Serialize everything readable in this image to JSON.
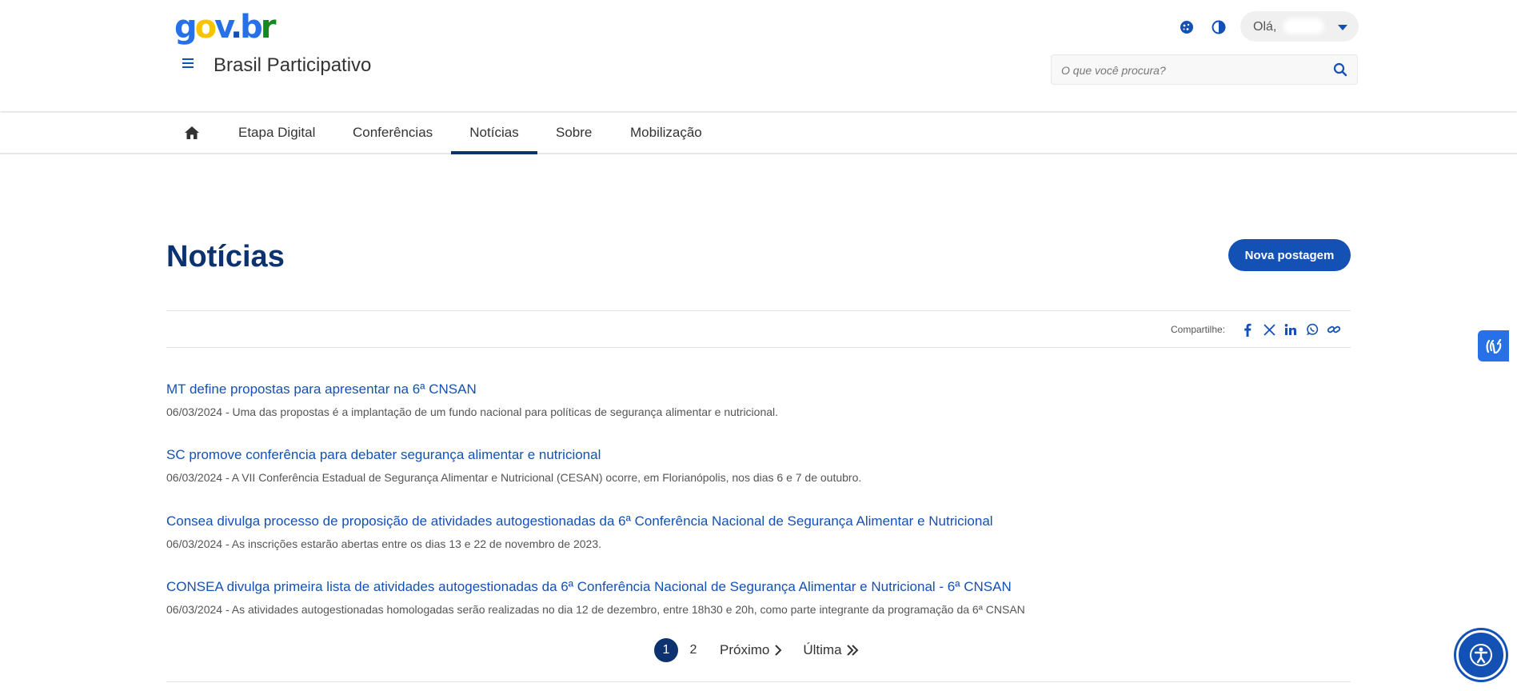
{
  "header": {
    "logo_text": "gov.br",
    "site_title": "Brasil Participativo",
    "greeting": "Olá,",
    "search_placeholder": "O que você procura?"
  },
  "nav": {
    "items": [
      "Etapa Digital",
      "Conferências",
      "Notícias",
      "Sobre",
      "Mobilização"
    ],
    "active": "Notícias"
  },
  "main": {
    "page_title": "Notícias",
    "new_post_label": "Nova postagem",
    "share_label": "Compartilhe:",
    "news": [
      {
        "title": "MT define propostas para apresentar na 6ª CNSAN",
        "meta": "06/03/2024 - Uma das propostas é a implantação de um fundo nacional para políticas de segurança alimentar e nutricional."
      },
      {
        "title": "SC promove conferência para debater segurança alimentar e nutricional",
        "meta": "06/03/2024 - A VII Conferência Estadual de Segurança Alimentar e Nutricional (CESAN) ocorre, em Florianópolis, nos dias 6 e 7 de outubro."
      },
      {
        "title": "Consea divulga processo de proposição de atividades autogestionadas da 6ª Conferência Nacional de Segurança Alimentar e Nutricional",
        "meta": "06/03/2024 - As inscrições estarão abertas entre os dias 13 e 22 de novembro de 2023."
      },
      {
        "title": "CONSEA divulga primeira lista de atividades autogestionadas da 6ª Conferência Nacional de Segurança Alimentar e Nutricional - 6ª CNSAN",
        "meta": "06/03/2024 - As atividades autogestionadas homologadas serão realizadas no dia 12 de dezembro, entre 18h30 e 20h, como parte integrante da programação da 6ª CNSAN"
      }
    ]
  },
  "pagination": {
    "pages": [
      "1",
      "2"
    ],
    "current": "1",
    "next_label": "Próximo",
    "last_label": "Última"
  },
  "colors": {
    "primary": "#1351b4",
    "title_blue": "#0c326f",
    "libras_blue": "#2670e8"
  }
}
